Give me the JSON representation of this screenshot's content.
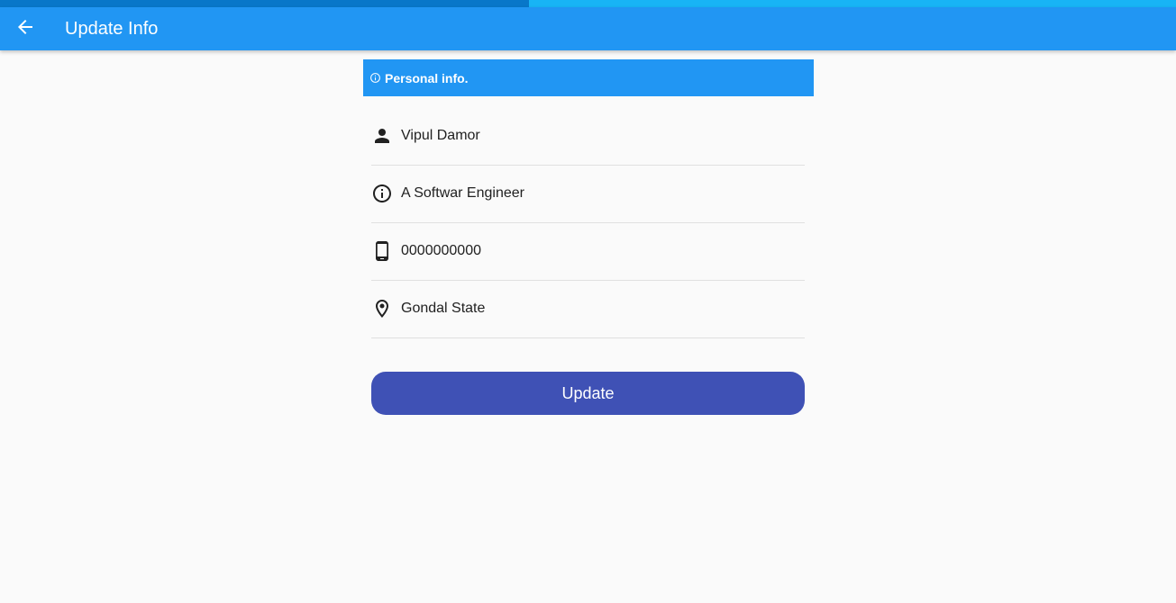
{
  "progress": {
    "value": 0.45
  },
  "app_bar": {
    "title": "Update Info",
    "back_icon": "arrow-back-icon"
  },
  "section": {
    "title": "Personal info.",
    "icon": "info-outline-icon"
  },
  "fields": [
    {
      "icon": "person-icon",
      "value": "Vipul Damor"
    },
    {
      "icon": "info-outline-icon",
      "value": "A Softwar Engineer"
    },
    {
      "icon": "phone-android-icon",
      "value": "0000000000"
    },
    {
      "icon": "location-pin-icon",
      "value": "Gondal State"
    }
  ],
  "update_button": {
    "label": "Update"
  },
  "colors": {
    "app_bar": "#2196f3",
    "button": "#3f51b5",
    "progress_track": "#18b4f5",
    "progress_fill": "#0877c9",
    "background": "#fafafa"
  }
}
